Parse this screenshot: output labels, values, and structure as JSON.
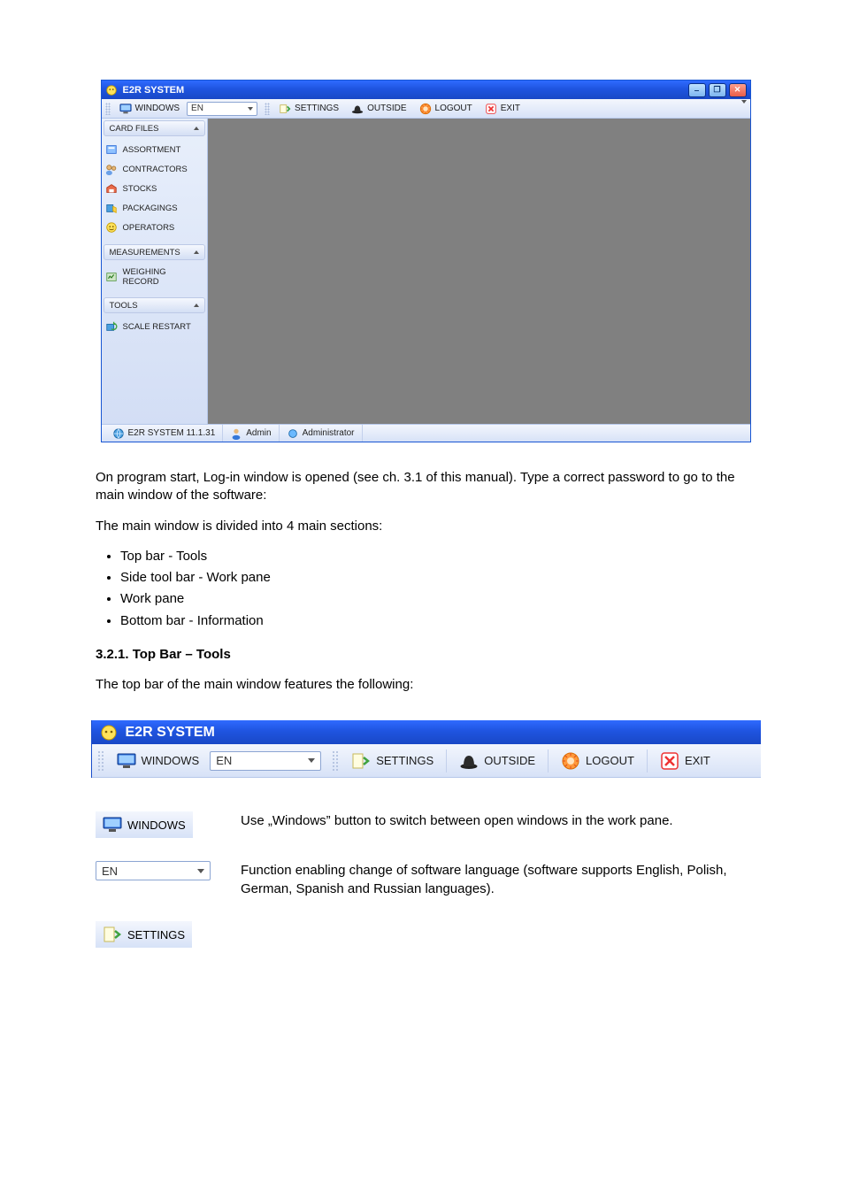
{
  "doc": {
    "intro": "On program start, Log-in window is opened (see ch. 3.1 of this manual). Type a correct password to go to the main window of the software:",
    "mainParts": "The main window is divided into 4 main sections:",
    "parts": [
      "Top bar - Tools",
      "Side tool bar - Work pane",
      "Work pane",
      "Bottom bar - Information"
    ],
    "section": "3.2.1. Top Bar – Tools",
    "sectionText": "The top bar of the main window features the following:",
    "windowsDesc": "Use „Windows” button to switch between open windows in the work pane.",
    "langDesc": "Function enabling change of software language (software supports English, Polish, German, Spanish and Russian languages).",
    "settingsLabel": "SETTINGS"
  },
  "app": {
    "title": "E2R SYSTEM"
  },
  "toolbar": {
    "windows": "WINDOWS",
    "langValue": "EN",
    "settings": "SETTINGS",
    "outside": "OUTSIDE",
    "logout": "LOGOUT",
    "exit": "EXIT"
  },
  "sidebar": {
    "group1": "CARD FILES",
    "items1": [
      "ASSORTMENT",
      "CONTRACTORS",
      "STOCKS",
      "PACKAGINGS",
      "OPERATORS"
    ],
    "group2": "MEASUREMENTS",
    "items2": [
      "WEIGHING RECORD"
    ],
    "group3": "TOOLS",
    "items3": [
      "SCALE RESTART"
    ]
  },
  "status": {
    "version": "E2R SYSTEM 11.1.31",
    "user": "Admin",
    "role": "Administrator"
  }
}
